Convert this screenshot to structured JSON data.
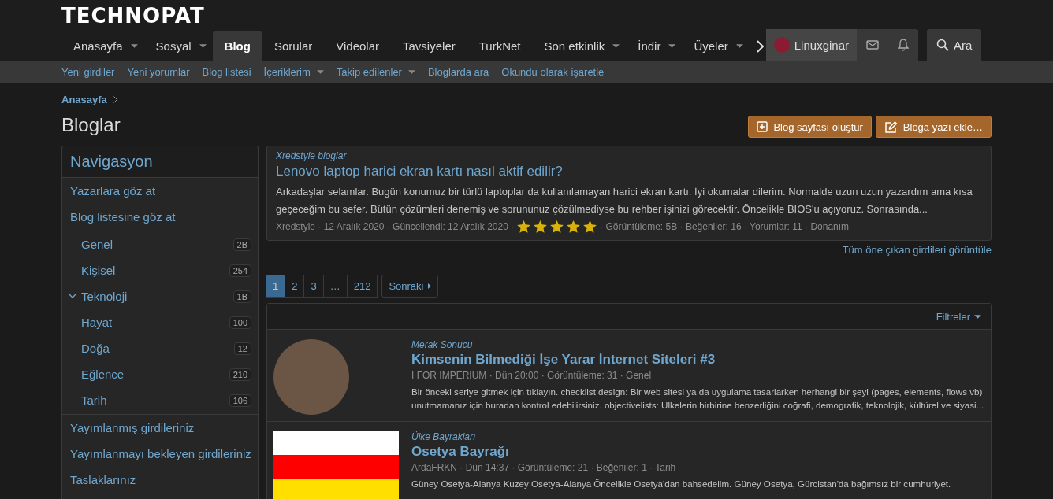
{
  "logo": "TECHNOPAT",
  "nav": {
    "tabs": [
      {
        "label": "Anasayfa",
        "dropdown": true,
        "selected": false
      },
      {
        "label": "Sosyal",
        "dropdown": true,
        "selected": false
      },
      {
        "label": "Blog",
        "dropdown": false,
        "selected": true
      },
      {
        "label": "Sorular",
        "dropdown": false,
        "selected": false
      },
      {
        "label": "Videolar",
        "dropdown": false,
        "selected": false
      },
      {
        "label": "Tavsiyeler",
        "dropdown": false,
        "selected": false
      },
      {
        "label": "TurkNet",
        "dropdown": false,
        "selected": false
      },
      {
        "label": "Son etkinlik",
        "dropdown": true,
        "selected": false
      },
      {
        "label": "İndir",
        "dropdown": true,
        "selected": false
      },
      {
        "label": "Üyeler",
        "dropdown": true,
        "selected": false
      }
    ],
    "user": "Linuxginar",
    "search": "Ara"
  },
  "subnav": [
    {
      "label": "Yeni girdiler",
      "dropdown": false
    },
    {
      "label": "Yeni yorumlar",
      "dropdown": false
    },
    {
      "label": "Blog listesi",
      "dropdown": false
    },
    {
      "label": "İçeriklerim",
      "dropdown": true
    },
    {
      "label": "Takip edilenler",
      "dropdown": true
    },
    {
      "label": "Bloglarda ara",
      "dropdown": false
    },
    {
      "label": "Okundu olarak işaretle",
      "dropdown": false
    }
  ],
  "breadcrumb": "Anasayfa",
  "title": "Bloglar",
  "actions": [
    {
      "kind": "create",
      "label": "Blog sayfası oluştur"
    },
    {
      "kind": "write",
      "label": "Bloga yazı ekle…"
    }
  ],
  "sidebar": {
    "title": "Navigasyon",
    "links_top": [
      "Yazarlara göz at",
      "Blog listesine göz at"
    ],
    "categories": [
      {
        "name": "Genel",
        "count": "2B",
        "expanded": false
      },
      {
        "name": "Kişisel",
        "count": "254",
        "expanded": false
      },
      {
        "name": "Teknoloji",
        "count": "1B",
        "expanded": true
      },
      {
        "name": "Hayat",
        "count": "100",
        "expanded": false
      },
      {
        "name": "Doğa",
        "count": "12",
        "expanded": false
      },
      {
        "name": "Eğlence",
        "count": "210",
        "expanded": false
      },
      {
        "name": "Tarih",
        "count": "106",
        "expanded": false
      }
    ],
    "links_bottom": [
      "Yayımlanmış girdileriniz",
      "Yayımlanmayı bekleyen girdileriniz",
      "Taslaklarınız"
    ]
  },
  "featured": {
    "blog": "Xredstyle bloglar",
    "title": "Lenovo laptop harici ekran kartı nasıl aktif edilir?",
    "body": "Arkadaşlar selamlar. Bugün konumuz bir türlü laptoplar da kullanılamayan harici ekran kartı. İyi okumalar dilerim. Normalde uzun uzun yazardım ama kısa geçeceğim bu sefer. Bütün çözümleri denemiş ve sorununuz çözülmediyse bu rehber işinizi görecektir. Öncelikle BIOS'u açıyoruz. Sonrasında...",
    "meta": "Xredstyle · 12 Aralık 2020 · Güncellendi: 12 Aralık 2020 ·",
    "stars": 5,
    "stats": "· Görüntüleme: 5B · Beğeniler: 16 · Yorumlar: 11 · Donanım",
    "more": "Tüm öne çıkan girdileri görüntüle"
  },
  "pagination": {
    "pages": [
      {
        "label": "1",
        "selected": true
      },
      {
        "label": "2",
        "selected": false
      },
      {
        "label": "3",
        "selected": false
      },
      {
        "label": "…",
        "selected": false
      },
      {
        "label": "212",
        "selected": false
      }
    ],
    "next": "Sonraki"
  },
  "list": {
    "filter": "Filtreler",
    "entries": [
      {
        "kind": "avatar",
        "blog": "Merak Sonucu",
        "title": "Kimsenin Bilmediği İşe Yarar İnternet Siteleri #3",
        "meta": "I FOR IMPERIUM · Dün 20:00 · Görüntüleme: 31 · Genel",
        "body": "Bir önceki seriye gitmek için tıklayın. checklist design: Bir web sitesi ya da uygulama tasarlarken herhangi bir şeyi (pages, elements, flows vb) unutmamanız için buradan kontrol edebilirsiniz. objectivelists: Ülkelerin birbirine benzerliğini coğrafi, demografik, teknolojik, kültürel ve siyasi..."
      },
      {
        "kind": "flag",
        "blog": "Ülke Bayrakları",
        "title": "Osetya Bayrağı",
        "meta": "ArdaFRKN · Dün 14:37 · Görüntüleme: 21 · Beğeniler: 1 · Tarih",
        "body": "Güney Osetya-Alanya Kuzey Osetya-Alanya Öncelikle Osetya'dan bahsedelim. Güney Osetya, Gürcistan'da bağımsız bir cumhuriyet."
      }
    ]
  }
}
